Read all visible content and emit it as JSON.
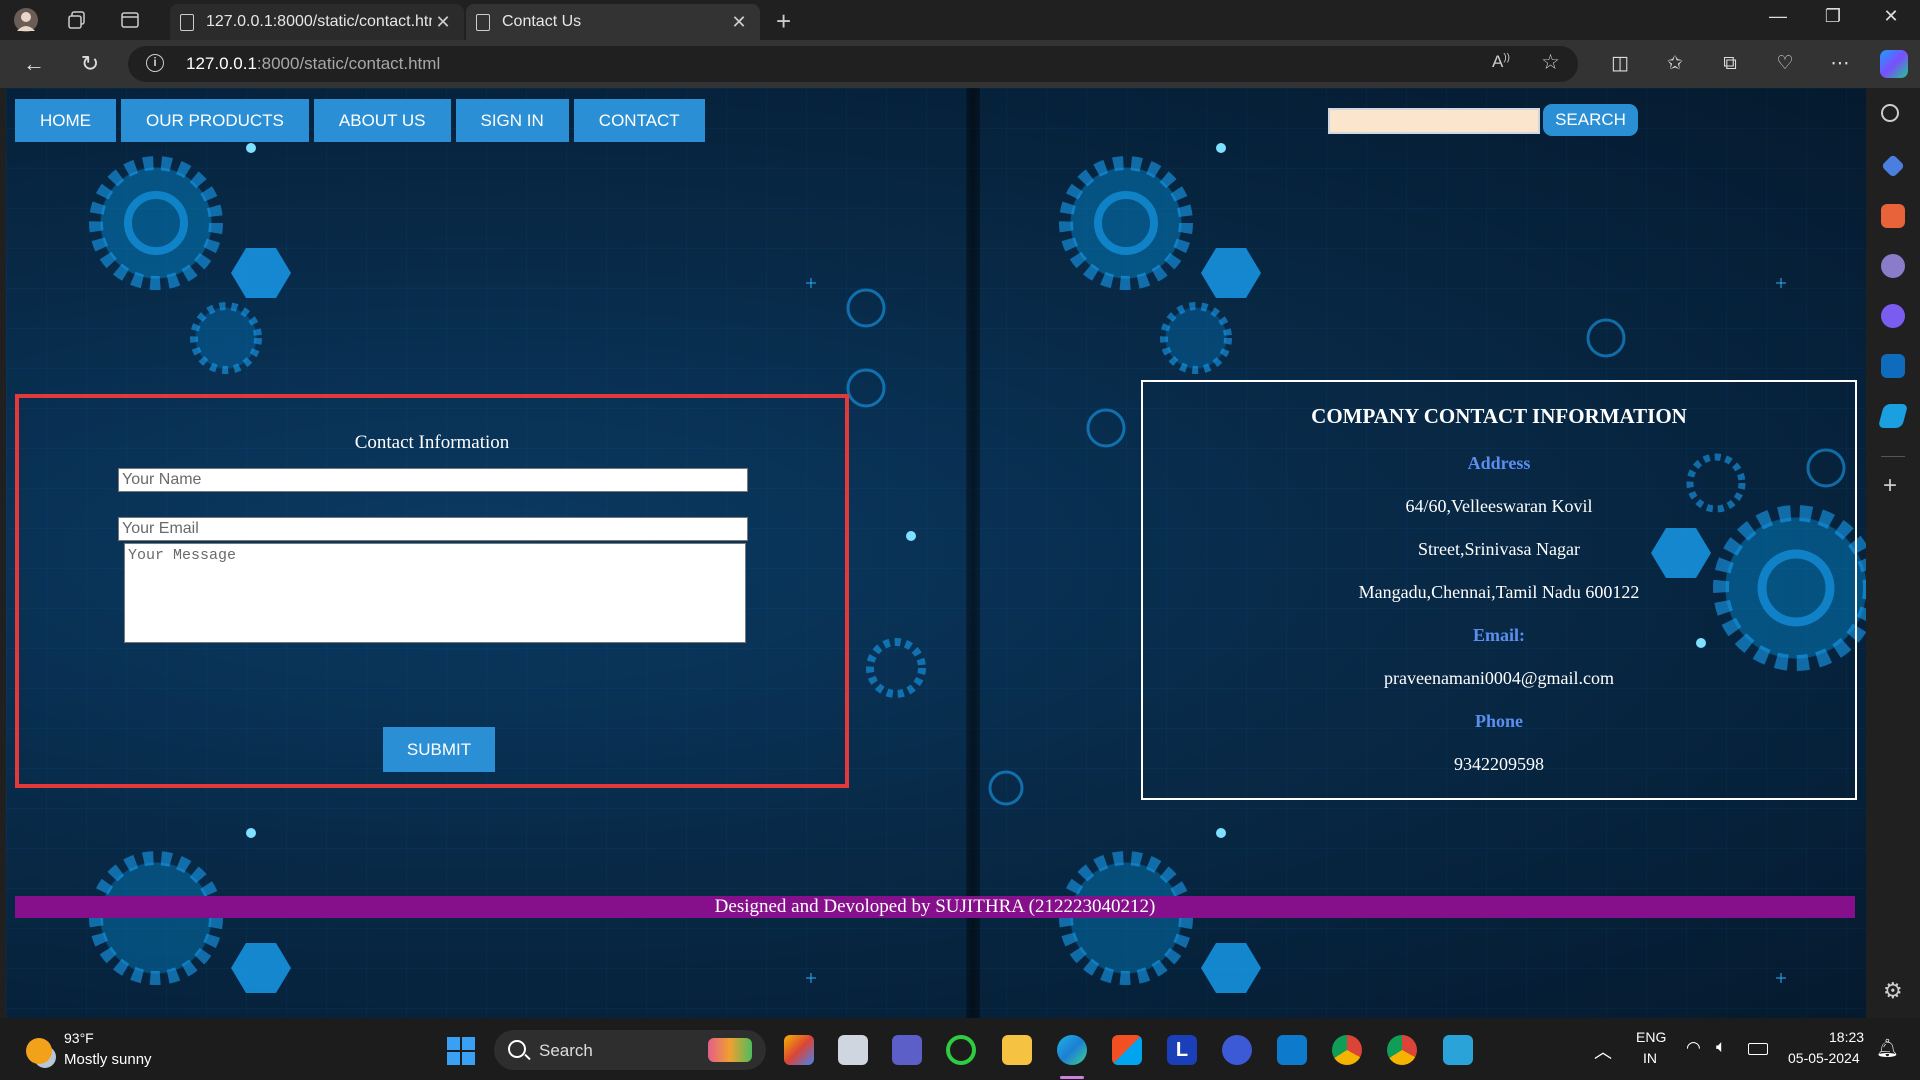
{
  "browser": {
    "tabs": [
      {
        "title": "127.0.0.1:8000/static/contact.htm"
      },
      {
        "title": "Contact Us"
      }
    ],
    "url_host": "127.0.0.1",
    "url_rest": ":8000/static/contact.html"
  },
  "nav": {
    "items": [
      "HOME",
      "OUR PRODUCTS",
      "ABOUT US",
      "SIGN IN",
      "CONTACT"
    ]
  },
  "search": {
    "value": "",
    "button_label": "SEARCH"
  },
  "contact_form": {
    "title": "Contact Information",
    "name_placeholder": "Your Name",
    "email_placeholder": "Your Email",
    "message_placeholder": "Your Message",
    "submit_label": "SUBMIT"
  },
  "company_info": {
    "heading": "COMPANY CONTACT INFORMATION",
    "address_label": "Address",
    "address_lines": [
      "64/60,Velleeswaran Kovil",
      "Street,Srinivasa Nagar",
      "Mangadu,Chennai,Tamil Nadu 600122"
    ],
    "email_label": "Email:",
    "email": "praveenamani0004@gmail.com",
    "phone_label": "Phone",
    "phone": "9342209598"
  },
  "footer": {
    "text": "Designed and Devoloped by SUJITHRA (212223040212)"
  },
  "taskbar": {
    "weather_temp": "93°F",
    "weather_desc": "Mostly sunny",
    "search_label": "Search",
    "lang_top": "ENG",
    "lang_bottom": "IN",
    "time": "18:23",
    "date": "05-05-2024"
  },
  "colors": {
    "nav_button": "#2a8fd4",
    "form_border": "#e4393b",
    "footer_bar": "#86108c",
    "info_label": "#5a8ff0"
  }
}
